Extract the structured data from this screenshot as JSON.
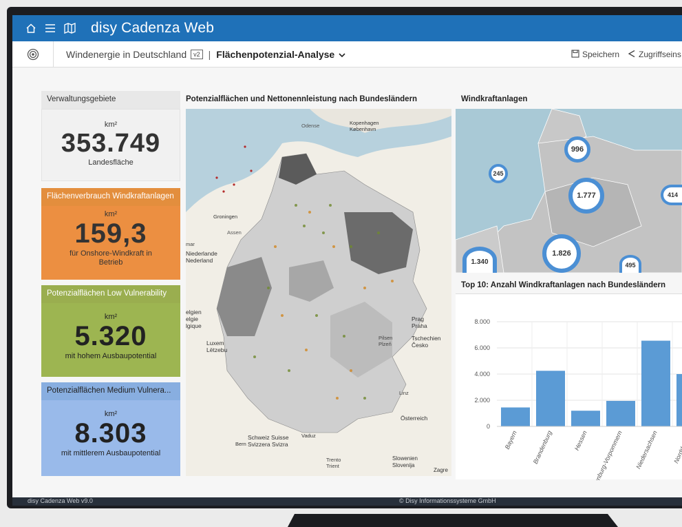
{
  "app": {
    "title": "disy Cadenza Web"
  },
  "subbar": {
    "project": "Windenergie in Deutschland",
    "version_badge": "v2",
    "separator": "|",
    "view_title": "Flächenpotenzial-Analyse",
    "save_label": "Speichern",
    "share_label": "Zugriffseins"
  },
  "kpis": {
    "admin": {
      "header": "Verwaltungsgebiete",
      "unit": "km²",
      "value": "353.749",
      "desc": "Landesfläche"
    },
    "wind_usage": {
      "header": "Flächenverbrauch Windkraftanlagen",
      "unit": "km²",
      "value": "159,3",
      "desc": "für Onshore-Windkraft in Betrieb"
    },
    "low_vuln": {
      "header": "Potenzialflächen Low Vulnerability",
      "unit": "km²",
      "value": "5.320",
      "desc": "mit hohem Ausbaupotential"
    },
    "med_vuln": {
      "header": "Potenzialflächen Medium Vulnera...",
      "unit": "km²",
      "value": "8.303",
      "desc": "mit mittlerem Ausbaupotential"
    }
  },
  "panels": {
    "main_map_title": "Potenzialflächen und Nettonennleistung nach Bundesländern",
    "wka_map_title": "Windkraftanlagen",
    "chart_title": "Top 10: Anzahl Windkraftanlagen nach Bundesländern"
  },
  "main_map_labels": {
    "odense": "Odense",
    "kopenhagen": "Kopenhagen København",
    "groningen": "Groningen",
    "niederlande": "Niederlande Nederland",
    "luxemburg": "Luxem Lëtzebu",
    "prag": "Prag Praha",
    "tschechien": "Tschechien Česko",
    "schweiz": "Schweiz Suisse Svizzera Svizra",
    "osterreich": "Österreich",
    "slowenien": "Slowenien Slovenija",
    "bern": "Bern",
    "vaduz": "Vaduz",
    "linz": "Linz",
    "pilsen": "Pilsen Plzeň",
    "zagre": "Zagre",
    "trento": "Trento Trient",
    "glen": "elgien elgie lgique",
    "assen": "Assen",
    "aymar": "mar"
  },
  "wka_bubbles": [
    {
      "label": "996",
      "color": "#4b8fd4"
    },
    {
      "label": "245",
      "color": "#4b8fd4"
    },
    {
      "label": "1.777",
      "color": "#4b8fd4"
    },
    {
      "label": "414",
      "color": "#4b8fd4"
    },
    {
      "label": "1.826",
      "color": "#4b8fd4"
    },
    {
      "label": "1.340",
      "color": "#4b8fd4"
    },
    {
      "label": "495",
      "color": "#4b8fd4"
    }
  ],
  "chart_data": {
    "type": "bar",
    "title": "Top 10: Anzahl Windkraftanlagen nach Bundesländern",
    "categories": [
      "Bayern",
      "Brandenburg",
      "Hessen",
      "Mecklenburg-Vorpommern",
      "Niedersachsen",
      "Nordrhein-W"
    ],
    "values": [
      1450,
      4250,
      1200,
      1950,
      6550,
      4000
    ],
    "yticks": [
      "0",
      "2.000",
      "4.000",
      "6.000",
      "8.000"
    ],
    "ylim": [
      0,
      8000
    ],
    "color": "#5b9bd5",
    "grid": true
  },
  "footer": {
    "version": "disy Cadenza Web v9.0",
    "copyright": "© Disy Informationssysteme GmbH"
  }
}
